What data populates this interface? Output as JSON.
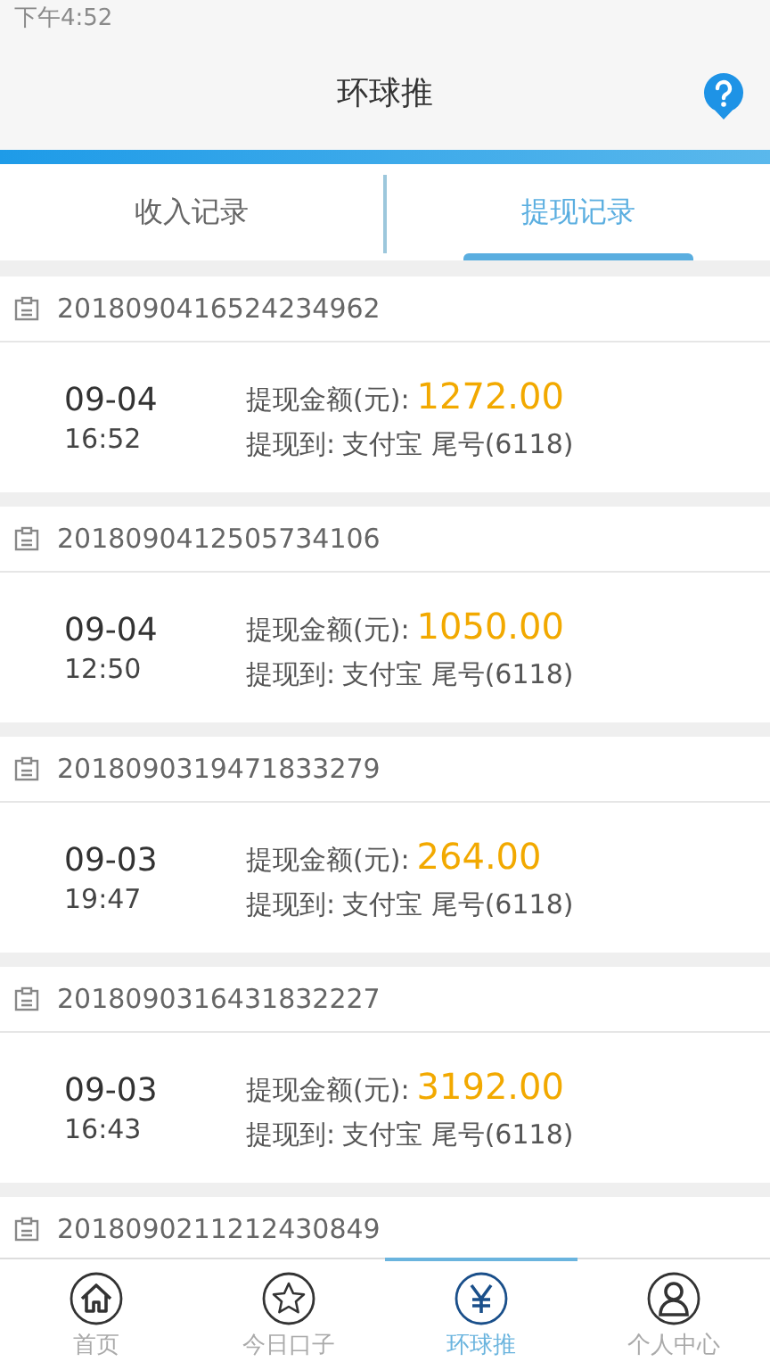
{
  "status_bar": {
    "time": "下午4:52"
  },
  "header": {
    "title": "环球推"
  },
  "tabs": [
    {
      "label": "收入记录",
      "selected": false
    },
    {
      "label": "提现记录",
      "selected": true
    }
  ],
  "records": [
    {
      "id": "2018090416524234962",
      "date": "09-04",
      "time": "16:52",
      "amount_label": "提现金额(元):",
      "amount": "1272.00",
      "to_label": "提现到:",
      "to": "支付宝 尾号(6118)"
    },
    {
      "id": "2018090412505734106",
      "date": "09-04",
      "time": "12:50",
      "amount_label": "提现金额(元):",
      "amount": "1050.00",
      "to_label": "提现到:",
      "to": "支付宝 尾号(6118)"
    },
    {
      "id": "2018090319471833279",
      "date": "09-03",
      "time": "19:47",
      "amount_label": "提现金额(元):",
      "amount": "264.00",
      "to_label": "提现到:",
      "to": "支付宝 尾号(6118)"
    },
    {
      "id": "2018090316431832227",
      "date": "09-03",
      "time": "16:43",
      "amount_label": "提现金额(元):",
      "amount": "3192.00",
      "to_label": "提现到:",
      "to": "支付宝 尾号(6118)"
    },
    {
      "id": "2018090211212430849"
    }
  ],
  "nav": [
    {
      "label": "首页",
      "kind": "home",
      "selected": false
    },
    {
      "label": "今日口子",
      "kind": "star",
      "selected": false
    },
    {
      "label": "环球推",
      "kind": "yen",
      "selected": true
    },
    {
      "label": "个人中心",
      "kind": "person",
      "selected": false
    }
  ]
}
